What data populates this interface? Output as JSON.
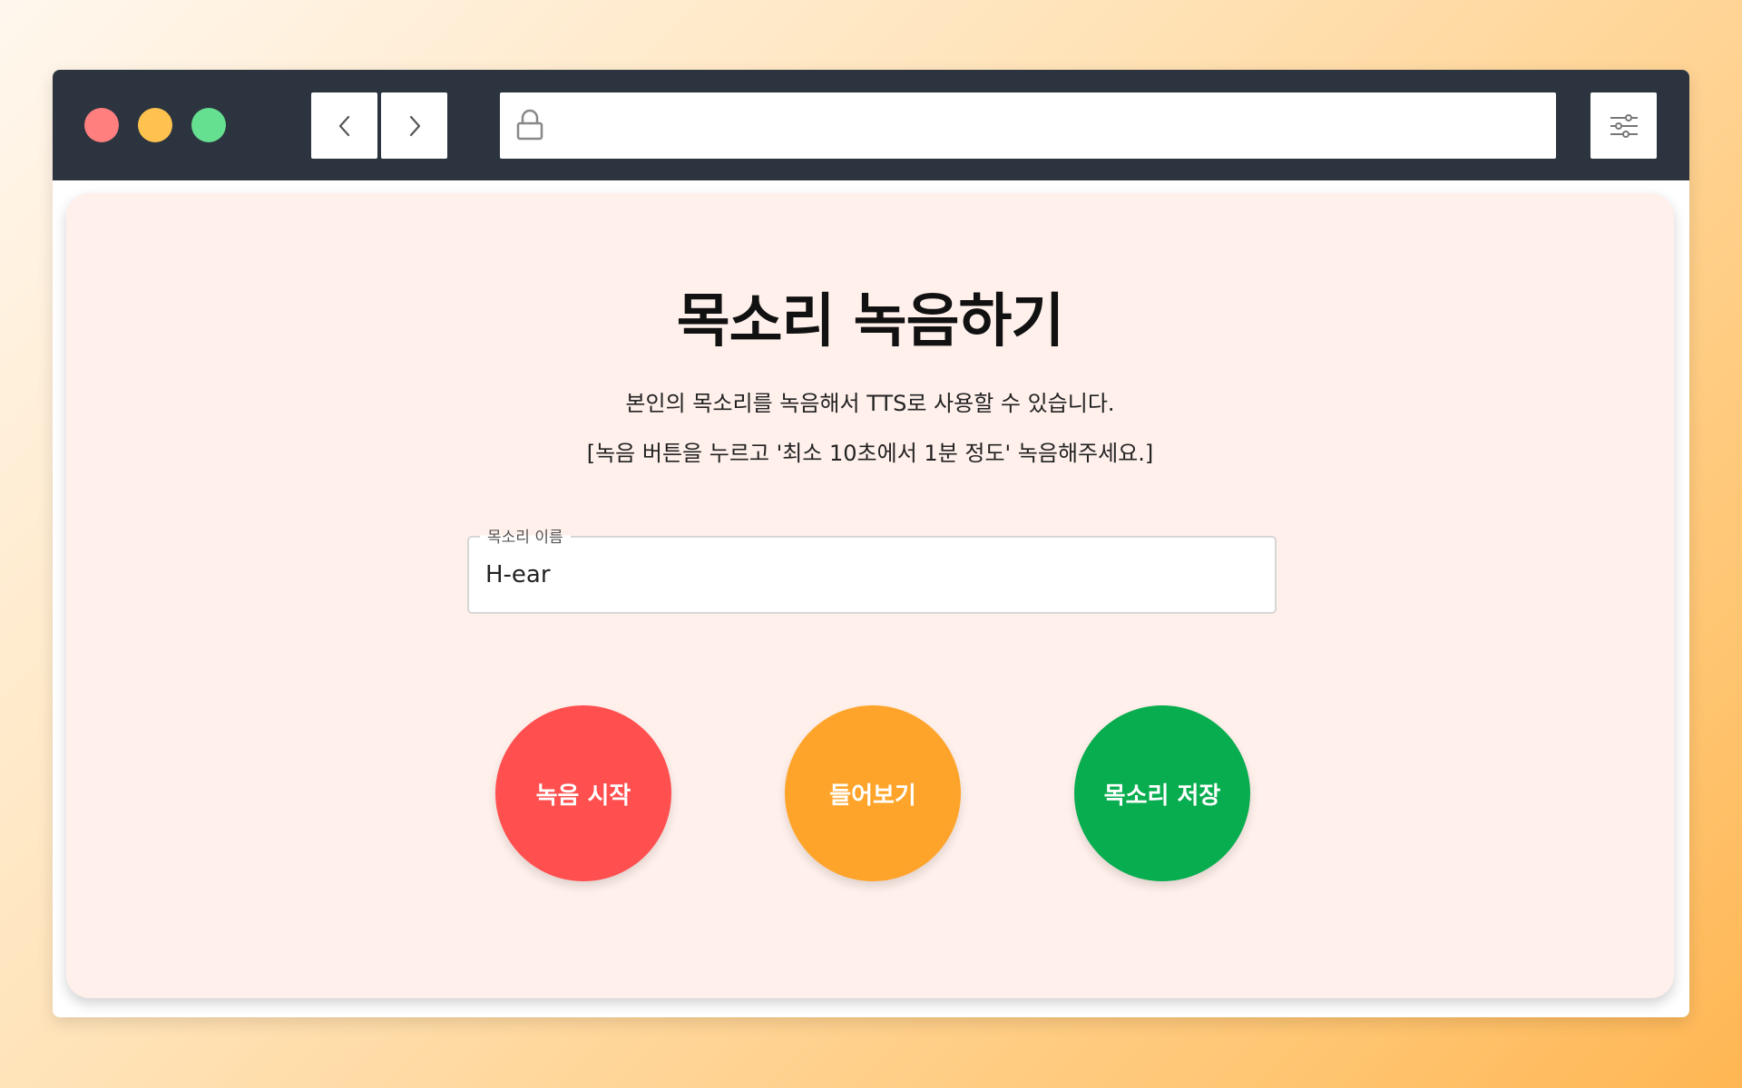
{
  "browser": {
    "icons": {
      "back": "chevron-left-icon",
      "forward": "chevron-right-icon",
      "lock": "lock-icon",
      "settings": "sliders-icon"
    },
    "url": ""
  },
  "page": {
    "title": "목소리 녹음하기",
    "description_line1": "본인의 목소리를 녹음해서 TTS로 사용할 수 있습니다.",
    "description_line2": "[녹음 버튼을 누르고 '최소 10초에서 1분 정도' 녹음해주세요.]",
    "voice_name": {
      "label": "목소리 이름",
      "value": "H-ear"
    },
    "buttons": {
      "record": "녹음 시작",
      "listen": "들어보기",
      "save": "목소리 저장"
    }
  },
  "colors": {
    "titlebar": "#2c353f",
    "card_background": "#fff0eb",
    "record_button": "#ff4f4f",
    "listen_button": "#ffa42a",
    "save_button": "#08ad4f",
    "close_dot": "#ff7f7f",
    "minimize_dot": "#ffc24f",
    "maximize_dot": "#65e090"
  }
}
